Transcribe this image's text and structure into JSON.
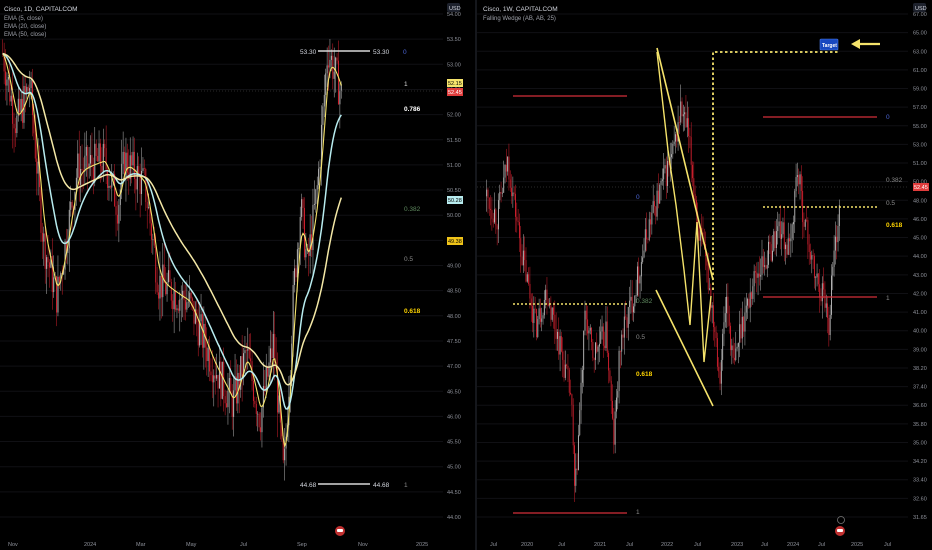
{
  "colors": {
    "bg": "#000000",
    "grid": "#101014",
    "axis_text": "#8f929b",
    "divider": "#2a2e39",
    "up": "#b8b8b8",
    "down": "#d0202e",
    "yellow": "#f5e36b",
    "gold": "#ffd400",
    "cyan": "#b8ecef",
    "cream": "#f4e8a6",
    "red_line": "#d32f3b",
    "white_line": "#d8d8d8",
    "blue_level": "#4d66d6",
    "green_level": "#5f8a5f",
    "badge_red": "#e03c3c",
    "badge_gold": "#f0c419",
    "badge_teal": "#b8ecef",
    "badge_yellow": "#f5e36b",
    "target_bg": "#1848c0",
    "gray_level": "#8a8a8a"
  },
  "left_panel": {
    "title": "Cisco, 1D, CAPITALCOM",
    "indicators": [
      "EMA (5, close)",
      "EMA (20, close)",
      "EMA (50, close)"
    ],
    "currency": "USD",
    "price_axis": [
      "54.00",
      "53.50",
      "53.00",
      "52.50",
      "52.00",
      "51.50",
      "51.00",
      "50.50",
      "50.00",
      "49.50",
      "49.00",
      "48.50",
      "48.00",
      "47.50",
      "47.00",
      "46.50",
      "46.00",
      "45.50",
      "45.00",
      "44.50",
      "44.00"
    ],
    "time_axis": [
      "Nov",
      "2024",
      "Mar",
      "May",
      "Jul",
      "Sep",
      "Nov",
      "2025"
    ],
    "price_badges": [
      {
        "text": "52.15",
        "color_key": "badge_yellow"
      },
      {
        "text": "52.45",
        "color_key": "badge_red"
      },
      {
        "text": "50.28",
        "color_key": "badge_teal"
      },
      {
        "text": "49.38",
        "color_key": "badge_gold"
      }
    ],
    "high_label": "53.30",
    "high_label_right": "53.30",
    "low_label": "44.68",
    "low_label_right": "44.68",
    "fib_levels": [
      {
        "label": "0",
        "color_key": "blue_level"
      },
      {
        "label": "1",
        "color_key": "white_line"
      },
      {
        "label": "0.786",
        "color_key": "white_line"
      },
      {
        "label": "0.382",
        "color_key": "green_level"
      },
      {
        "label": "0.5",
        "color_key": "gray_level"
      },
      {
        "label": "0.618",
        "color_key": "gold"
      },
      {
        "label": "1",
        "color_key": "gray_level"
      }
    ]
  },
  "right_panel": {
    "title": "Cisco, 1W, CAPITALCOM",
    "indicators": [
      "Falling Wedge (AB, AB, 25)"
    ],
    "currency": "USD",
    "price_axis": [
      "67.00",
      "65.00",
      "63.00",
      "61.00",
      "59.00",
      "57.00",
      "55.00",
      "53.00",
      "51.00",
      "50.00",
      "48.00",
      "46.00",
      "45.00",
      "44.00",
      "43.00",
      "42.00",
      "41.00",
      "40.00",
      "39.00",
      "38.20",
      "37.40",
      "36.60",
      "35.80",
      "35.00",
      "34.20",
      "33.40",
      "32.60",
      "31.65"
    ],
    "time_axis": [
      "Jul",
      "2020",
      "Jul",
      "2021",
      "Jul",
      "2022",
      "Jul",
      "2023",
      "Jul",
      "2024",
      "Jul",
      "2025",
      "Jul"
    ],
    "price_badges": [
      {
        "text": "52.45",
        "color_key": "badge_red"
      }
    ],
    "target_label": "Target",
    "fib_left": [
      {
        "label": "0",
        "color_key": "blue_level"
      },
      {
        "label": "0.382",
        "color_key": "green_level"
      },
      {
        "label": "0.5",
        "color_key": "gray_level"
      },
      {
        "label": "0.618",
        "color_key": "gold"
      },
      {
        "label": "1",
        "color_key": "gray_level"
      }
    ],
    "fib_right": [
      {
        "label": "0",
        "color_key": "blue_level"
      },
      {
        "label": "0.382",
        "color_key": "gray_level"
      },
      {
        "label": "0.5",
        "color_key": "gray_level"
      },
      {
        "label": "0.618",
        "color_key": "gold"
      },
      {
        "label": "1",
        "color_key": "gray_level"
      }
    ]
  },
  "chart_data": [
    {
      "type": "candlestick",
      "title": "Cisco, 1D, CAPITALCOM",
      "ylim": [
        44.0,
        54.1
      ],
      "series": [
        {
          "name": "EMA (5, close)"
        },
        {
          "name": "EMA (20, close)"
        },
        {
          "name": "EMA (50, close)"
        }
      ],
      "annotations": {
        "swing_high": 53.3,
        "swing_low": 44.68,
        "last_close": 52.45
      }
    },
    {
      "type": "candlestick",
      "title": "Cisco, 1W, CAPITALCOM",
      "ylim": [
        31.65,
        67.0
      ],
      "annotations": {
        "pattern": "Falling Wedge (AB, AB, 25)",
        "last_close": 52.45
      }
    }
  ]
}
